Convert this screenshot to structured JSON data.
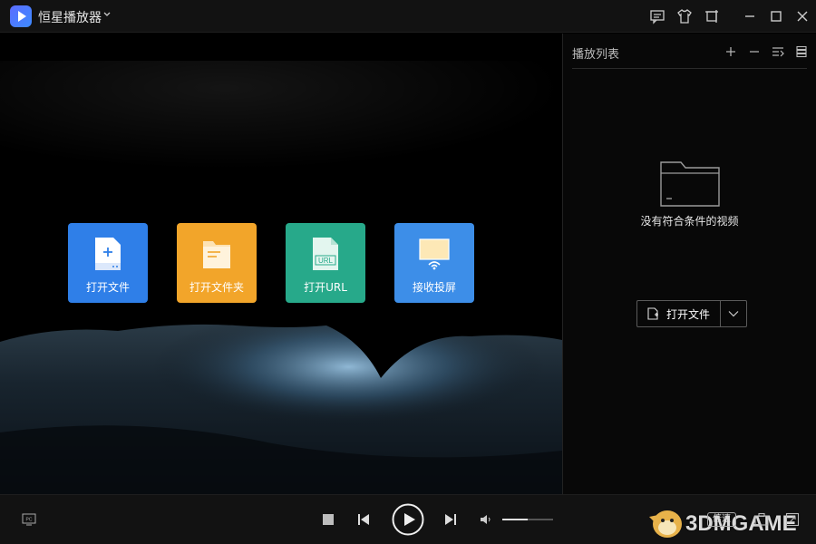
{
  "app": {
    "title": "恒星播放器"
  },
  "tiles": [
    {
      "label": "打开文件",
      "color": "#2f7fe8"
    },
    {
      "label": "打开文件夹",
      "color": "#f2a52a"
    },
    {
      "label": "打开URL",
      "color": "#27a98a",
      "icon_text": "URL"
    },
    {
      "label": "接收投屏",
      "color": "#3d8ee8"
    }
  ],
  "playlist": {
    "title": "播放列表",
    "empty_text": "没有符合条件的视频",
    "open_button": "打开文件"
  },
  "controls": {
    "speed_label": "倍速",
    "pc_label": "PC",
    "volume": 0.5
  },
  "watermark": {
    "text": "3DMGAME"
  }
}
